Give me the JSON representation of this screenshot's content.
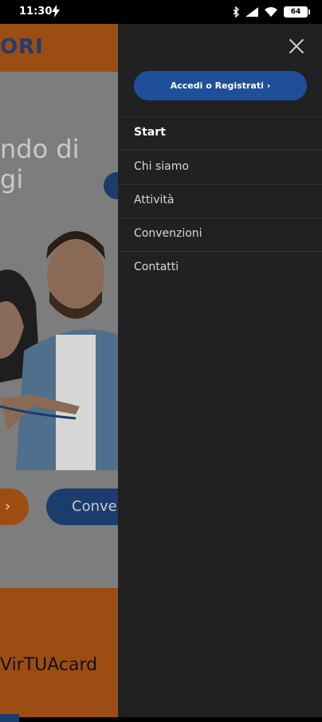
{
  "status_bar": {
    "time": "11:30",
    "battery": "64"
  },
  "background": {
    "logo": "ORI",
    "hero_line1": "ndo di",
    "hero_line2": "gi",
    "button_orange_glyph": "›",
    "button_blue_label": "Conven",
    "card_text": "VirTUAcard"
  },
  "drawer": {
    "login_button": "Accedi o Registrati ›",
    "menu": [
      {
        "label": "Start"
      },
      {
        "label": "Chi siamo"
      },
      {
        "label": "Attività"
      },
      {
        "label": "Convenzioni"
      },
      {
        "label": "Contatti"
      }
    ]
  },
  "colors": {
    "drawer_bg": "#212121",
    "accent_blue": "#1f4f99",
    "orange": "#9c4d12"
  }
}
